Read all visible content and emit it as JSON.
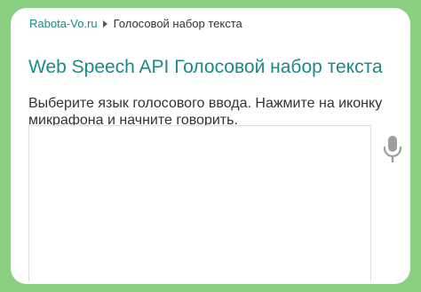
{
  "breadcrumb": {
    "site_link": "Rabota-Vo.ru",
    "current": "Голосовой набор текста"
  },
  "page": {
    "title": "Web Speech API Голосовой набор текста",
    "instruction": "Выберите язык голосового ввода. Нажмите на иконку микрафона и начните говорить."
  },
  "speech_input": {
    "value": ""
  },
  "icons": {
    "breadcrumb_separator": "triangle-right-icon",
    "microphone": "microphone-icon"
  },
  "colors": {
    "background": "#8bcf83",
    "accent": "#1a8a86",
    "text": "#333333",
    "icon": "#9e9e9e"
  }
}
